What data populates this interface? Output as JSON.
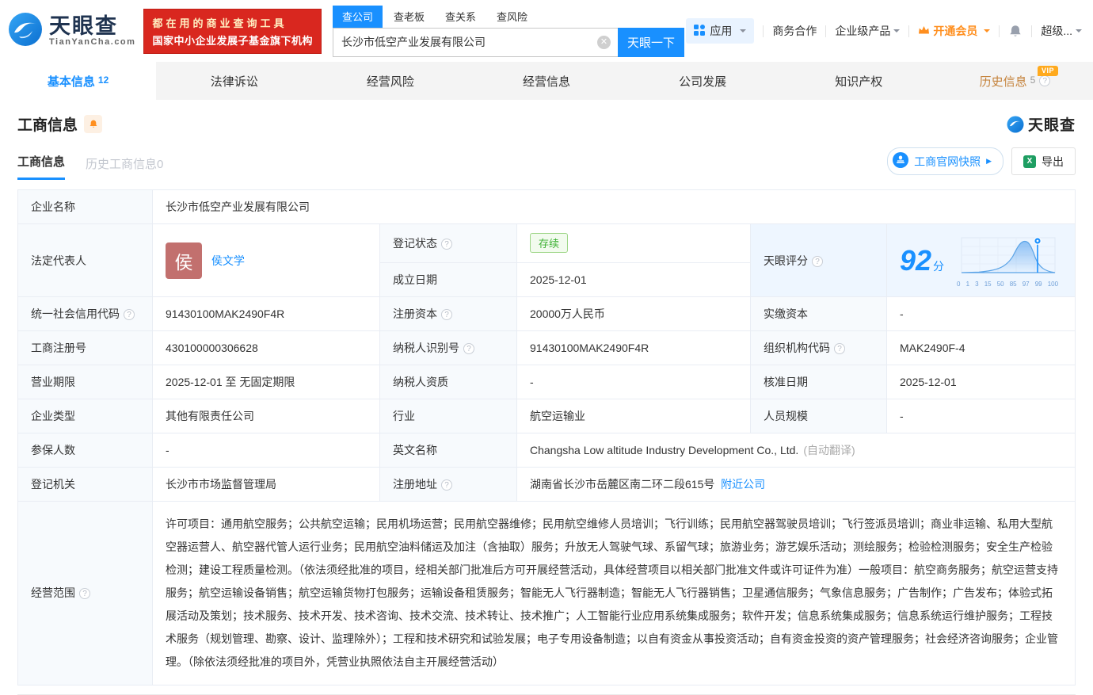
{
  "header": {
    "logo": {
      "brand": "天眼查",
      "domain": "TianYanCha.com"
    },
    "promo": {
      "line1": "都在用的商业查询工具",
      "line2": "国家中小企业发展子基金旗下机构"
    },
    "search": {
      "tabs": [
        {
          "label": "查公司"
        },
        {
          "label": "查老板"
        },
        {
          "label": "查关系"
        },
        {
          "label": "查风险"
        }
      ],
      "value": "长沙市低空产业发展有限公司",
      "submit": "天眼一下"
    },
    "nav": {
      "apps": "应用",
      "cooperation": "商务合作",
      "enterprise": "企业级产品",
      "membership": "开通会员",
      "account": "超级..."
    }
  },
  "tabs": [
    {
      "label": "基本信息",
      "count": "12"
    },
    {
      "label": "法律诉讼",
      "count": ""
    },
    {
      "label": "经营风险",
      "count": ""
    },
    {
      "label": "经营信息",
      "count": ""
    },
    {
      "label": "公司发展",
      "count": ""
    },
    {
      "label": "知识产权",
      "count": ""
    },
    {
      "label": "历史信息",
      "count": "5",
      "badge": "VIP"
    }
  ],
  "section": {
    "title": "工商信息",
    "watermark": "天眼查",
    "subtabs": [
      {
        "label": "工商信息"
      },
      {
        "label": "历史工商信息0"
      }
    ],
    "snapshot_button": "工商官网快照",
    "export_button": "导出"
  },
  "fields": {
    "company_name": {
      "label": "企业名称",
      "value": "长沙市低空产业发展有限公司"
    },
    "legal_rep": {
      "label": "法定代表人",
      "avatar": "侯",
      "name": "侯文学"
    },
    "reg_status": {
      "label": "登记状态",
      "value": "存续"
    },
    "establish_date": {
      "label": "成立日期",
      "value": "2025-12-01"
    },
    "tyc_score": {
      "label": "天眼评分"
    },
    "credit_code": {
      "label": "统一社会信用代码",
      "value": "91430100MAK2490F4R"
    },
    "reg_capital": {
      "label": "注册资本",
      "value": "20000万人民币"
    },
    "paid_capital": {
      "label": "实缴资本",
      "value": "-"
    },
    "reg_number": {
      "label": "工商注册号",
      "value": "430100000306628"
    },
    "taxpayer_id": {
      "label": "纳税人识别号",
      "value": "91430100MAK2490F4R"
    },
    "org_code": {
      "label": "组织机构代码",
      "value": "MAK2490F-4"
    },
    "business_term": {
      "label": "营业期限",
      "value": "2025-12-01 至 无固定期限"
    },
    "taxpayer_quality": {
      "label": "纳税人资质",
      "value": "-"
    },
    "approval_date": {
      "label": "核准日期",
      "value": "2025-12-01"
    },
    "company_type": {
      "label": "企业类型",
      "value": "其他有限责任公司"
    },
    "industry": {
      "label": "行业",
      "value": "航空运输业"
    },
    "staff_size": {
      "label": "人员规模",
      "value": "-"
    },
    "insured_count": {
      "label": "参保人数",
      "value": "-"
    },
    "english_name": {
      "label": "英文名称",
      "value": "Changsha Low altitude Industry Development Co., Ltd.",
      "note": "(自动翻译)"
    },
    "reg_authority": {
      "label": "登记机关",
      "value": "长沙市市场监督管理局"
    },
    "reg_address": {
      "label": "注册地址",
      "value": "湖南省长沙市岳麓区南二环二段615号",
      "link": "附近公司"
    },
    "business_scope": {
      "label": "经营范围",
      "value": "许可项目：通用航空服务；公共航空运输；民用机场运营；民用航空器维修；民用航空维修人员培训；飞行训练；民用航空器驾驶员培训；飞行签派员培训；商业非运输、私用大型航空器运营人、航空器代管人运行业务；民用航空油料储运及加注（含抽取）服务；升放无人驾驶气球、系留气球；旅游业务；游艺娱乐活动；测绘服务；检验检测服务；安全生产检验检测；建设工程质量检测。（依法须经批准的项目，经相关部门批准后方可开展经营活动，具体经营项目以相关部门批准文件或许可证件为准）一般项目：航空商务服务；航空运营支持服务；航空运输设备销售；航空运输货物打包服务；运输设备租赁服务；智能无人飞行器制造；智能无人飞行器销售；卫星通信服务；气象信息服务；广告制作；广告发布；体验式拓展活动及策划；技术服务、技术开发、技术咨询、技术交流、技术转让、技术推广；人工智能行业应用系统集成服务；软件开发；信息系统集成服务；信息系统运行维护服务；工程技术服务（规划管理、勘察、设计、监理除外）；工程和技术研究和试验发展；电子专用设备制造；以自有资金从事投资活动；自有资金投资的资产管理服务；社会经济咨询服务；企业管理。（除依法须经批准的项目外，凭营业执照依法自主开展经营活动）"
    }
  },
  "score_chart": {
    "score": "92",
    "unit": "分",
    "axis_labels": [
      "0",
      "1",
      "3",
      "15",
      "50",
      "85",
      "97",
      "99",
      "100"
    ]
  }
}
